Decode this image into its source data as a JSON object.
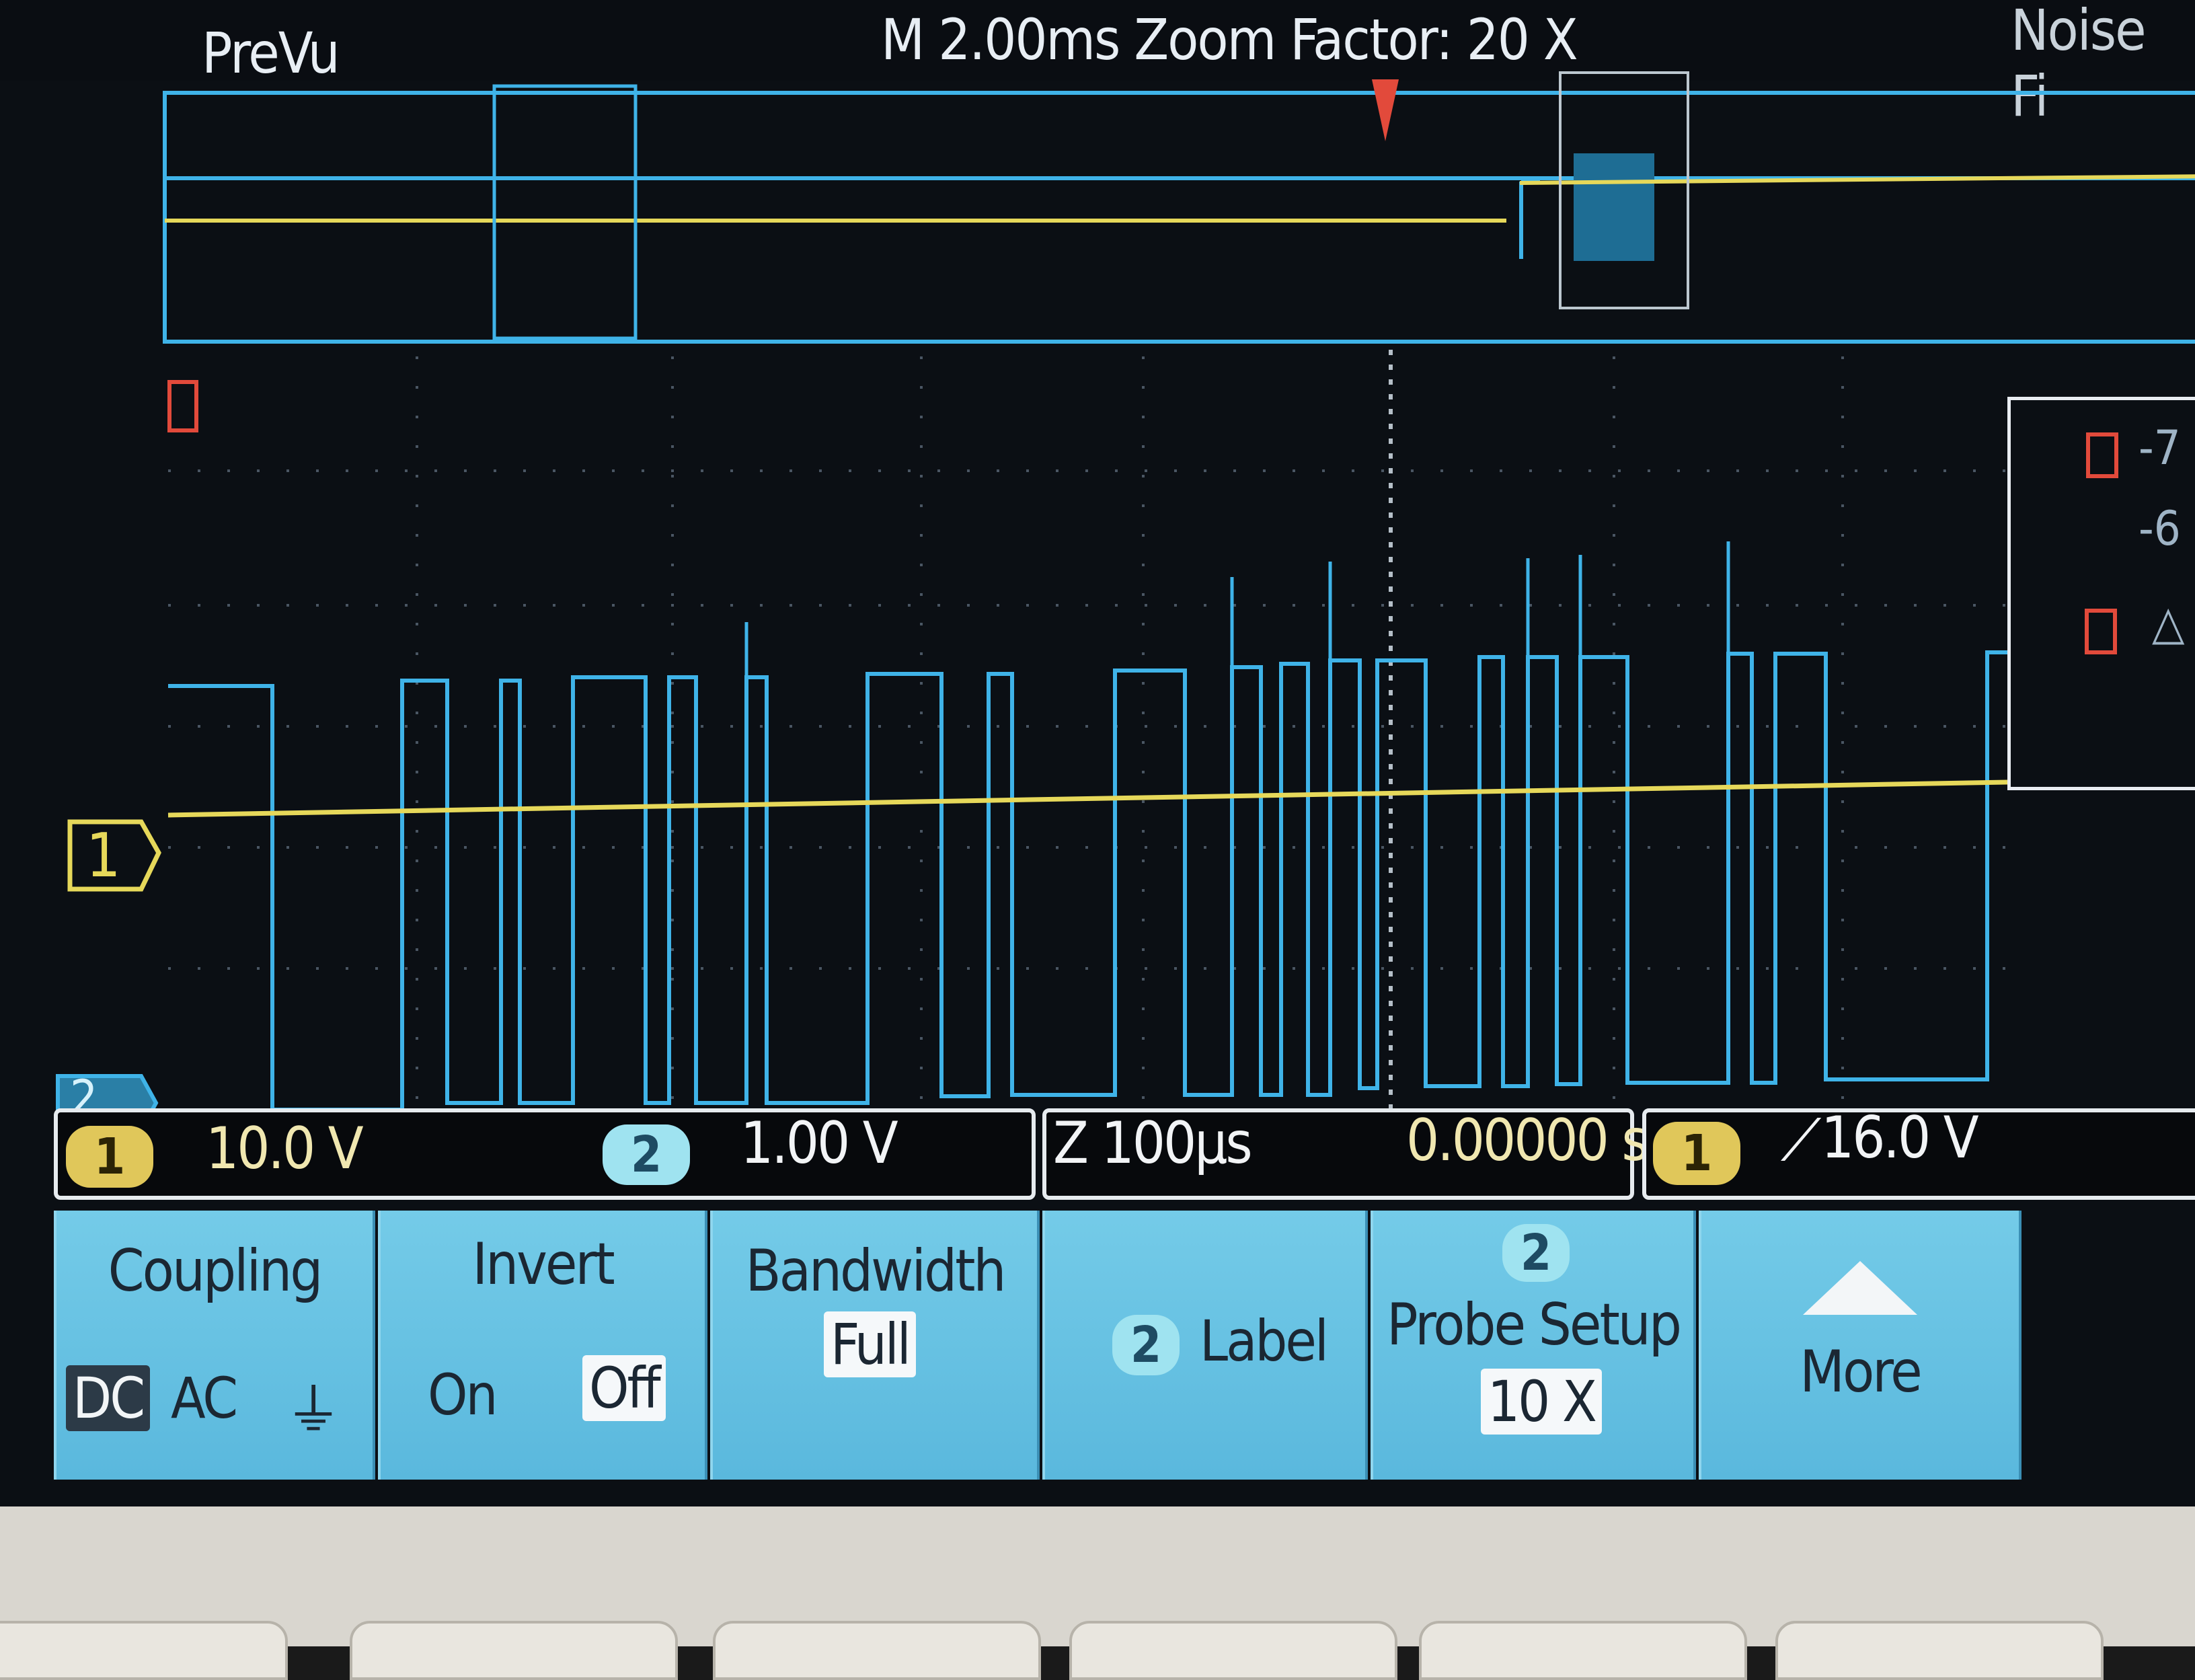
{
  "header": {
    "mode": "PreVu",
    "timebase_zoom": "M 2.00ms  Zoom Factor: 20 X",
    "right_label": "Noise Fi"
  },
  "colors": {
    "ch1": "#e6d85a",
    "ch2": "#3fb3e8",
    "menu_bg": "#5ab8dd",
    "trigger": "#e24a3b"
  },
  "markers": {
    "ch1": "1",
    "ch2": "2"
  },
  "readout": {
    "ch1_num": "1",
    "ch1_scale": "10.0 V",
    "ch2_num": "2",
    "ch2_scale": "1.00 V",
    "zoom_scale": "Z 100µs",
    "position": "0.00000 s",
    "trig_ch": "1",
    "trig_level": "16.0 V"
  },
  "menu": {
    "coupling": {
      "title": "Coupling",
      "options": [
        "DC",
        "AC",
        "⏚"
      ],
      "selected": "DC"
    },
    "invert": {
      "title": "Invert",
      "on": "On",
      "off": "Off",
      "selected": "Off"
    },
    "bandwidth": {
      "title": "Bandwidth",
      "value": "Full"
    },
    "label": {
      "channel": "2",
      "title": "Label"
    },
    "probe_setup": {
      "channel": "2",
      "title": "Probe Setup",
      "value": "10 X"
    },
    "more": {
      "title": "More"
    }
  },
  "panel": {
    "row1": "-7",
    "row2": "-6",
    "row3": "△"
  }
}
